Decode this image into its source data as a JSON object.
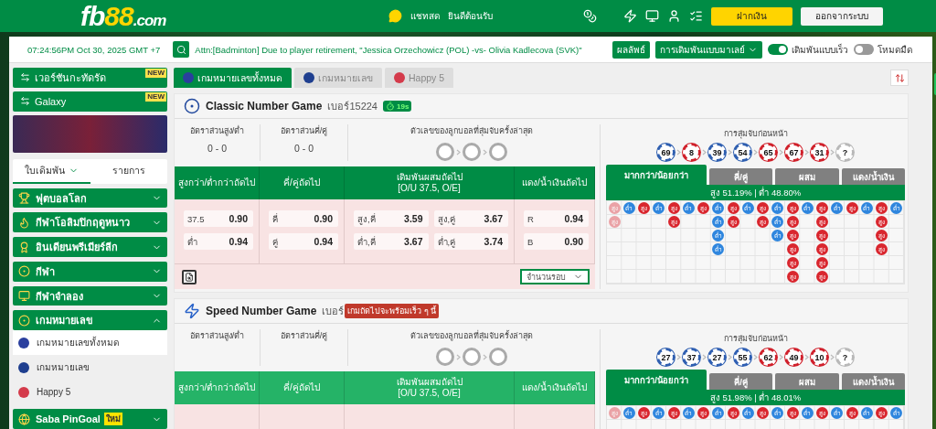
{
  "header": {
    "logo": [
      "fb",
      "88",
      ".com"
    ],
    "chat": "แชทสด",
    "welcome": "ยินดีต้อนรับ",
    "buttons": [
      {
        "label": "ฝากเงิน",
        "kind": "primary"
      },
      {
        "label": "ออกจากระบบ",
        "kind": "secondary"
      }
    ]
  },
  "ticker": {
    "time": "07:24:56PM Oct 30, 2025 GMT +7",
    "message": "Attn:[Badminton] Due to player retirement, \"Jessica Orzechowicz (POL) -vs- Olivia Kadlecova (SVK)\"",
    "results": "ผลลัพธ์",
    "odds_type": "การเดิมพันแบบมาเลย์",
    "toggles": [
      {
        "label": "เดิมพันแบบเร็ว",
        "on": true
      },
      {
        "label": "โหมดมืด",
        "on": false
      }
    ]
  },
  "sidebar": {
    "promos": [
      {
        "label": "เวอร์ชันกะทัดรัด",
        "badge": "NEW"
      },
      {
        "label": "Galaxy",
        "badge": "NEW"
      }
    ],
    "tabs": [
      {
        "label": "ใบเดิมพัน",
        "selected": true
      },
      {
        "label": "รายการ",
        "selected": false
      }
    ],
    "menu": [
      {
        "label": "ฟุตบอลโลก",
        "expanded": false
      },
      {
        "label": "กีฬาโอลิมปิกฤดูหนาว",
        "expanded": false
      },
      {
        "label": "อินเดียนพรีเมียร์ลีก",
        "expanded": false
      },
      {
        "label": "กีฬา",
        "expanded": false
      },
      {
        "label": "กีฬาจำลอง",
        "expanded": false
      },
      {
        "label": "เกมหมายเลข",
        "expanded": true,
        "children": [
          {
            "label": "เกมหมายเลขทั้งหมด",
            "selected": true
          },
          {
            "label": "เกมหมายเลข",
            "selected": false
          },
          {
            "label": "Happy 5",
            "selected": false
          }
        ]
      },
      {
        "label": "Saba PinGoal",
        "badge": "ใหม่",
        "expanded": false
      }
    ]
  },
  "game_tabs": [
    {
      "label": "เกมหมายเลขทั้งหมด",
      "selected": true
    },
    {
      "label": "เกมหมายเลข",
      "selected": false
    },
    {
      "label": "Happy 5",
      "selected": false
    }
  ],
  "games": [
    {
      "kind": "classic",
      "name": "Classic Number Game",
      "number": "เบอร์15224",
      "timer": "19s",
      "stats": [
        {
          "label": "อัตราส่วนสูง/ต่ำ",
          "value": "0 - 0"
        },
        {
          "label": "อัตราส่วนคี่/คู่",
          "value": "0 - 0"
        }
      ],
      "last_draw_label": "ตัวเลขของลูกบอลที่สุ่มจับครั้งล่าสุด",
      "prev_label": "การสุ่มจับก่อนหน้า",
      "prev_draws": [
        {
          "number": "69",
          "color": "#2f5fb0"
        },
        {
          "number": "8",
          "color": "#d0202a"
        },
        {
          "number": "39",
          "color": "#2f5fb0"
        },
        {
          "number": "54",
          "color": "#2f5fb0"
        },
        {
          "number": "65",
          "color": "#d0202a"
        },
        {
          "number": "67",
          "color": "#d0202a"
        },
        {
          "number": "31",
          "color": "#d0202a"
        },
        {
          "number": "?",
          "color": "#b8b8b8"
        }
      ],
      "columns": [
        {
          "title": "สูงกว่า/ต่ำกว่าถัดไป"
        },
        {
          "title": "คี่/คู่ถัดไป"
        },
        {
          "title": "เดิมพันผสมถัดไป",
          "subtitle": "[O/U 37.5, O/E]"
        },
        {
          "title": "แดง/น้ำเงินถัดไป"
        }
      ],
      "odds": [
        [
          {
            "label": "37.5",
            "value": "0.90"
          },
          {
            "label": "ต่ำ",
            "value": "0.94"
          }
        ],
        [
          {
            "label": "คี่",
            "value": "0.90"
          },
          {
            "label": "คู่",
            "value": "0.94"
          }
        ],
        [
          {
            "label": "สูง,คี่",
            "value": "3.59"
          },
          {
            "label": "สูง,คู่",
            "value": "3.67"
          },
          {
            "label": "ต่ำ,คี่",
            "value": "3.67"
          },
          {
            "label": "ต่ำ,คู่",
            "value": "3.74"
          }
        ],
        [
          {
            "label": "R",
            "value": "0.94"
          },
          {
            "label": "B",
            "value": "0.90"
          }
        ]
      ],
      "rounds": "จำนวนรอบ",
      "trend_tabs": [
        {
          "label": "มากกว่า/น้อยกว่า",
          "selected": true
        },
        {
          "label": "คี่/คู่",
          "selected": false
        },
        {
          "label": "ผสม",
          "selected": false
        },
        {
          "label": "แดง/น้ำเงิน",
          "selected": false
        }
      ],
      "summary": "สูง 51.19% | ต่ำ 48.80%",
      "road": [
        {
          "faded": true,
          "cells": [
            {
              "label": "สูง",
              "kind": "high"
            },
            {
              "label": "สูง",
              "kind": "high"
            }
          ]
        },
        {
          "faded": false,
          "cells": [
            {
              "label": "ต่ำ",
              "kind": "low"
            }
          ]
        },
        {
          "faded": false,
          "cells": [
            {
              "label": "สูง",
              "kind": "high"
            }
          ]
        },
        {
          "faded": false,
          "cells": [
            {
              "label": "ต่ำ",
              "kind": "low"
            }
          ]
        },
        {
          "faded": false,
          "cells": [
            {
              "label": "สูง",
              "kind": "high"
            },
            {
              "label": "สูง",
              "kind": "high"
            }
          ]
        },
        {
          "faded": false,
          "cells": [
            {
              "label": "ต่ำ",
              "kind": "low"
            }
          ]
        },
        {
          "faded": false,
          "cells": [
            {
              "label": "สูง",
              "kind": "high"
            }
          ]
        },
        {
          "faded": false,
          "cells": [
            {
              "label": "ต่ำ",
              "kind": "low"
            },
            {
              "label": "ต่ำ",
              "kind": "low"
            },
            {
              "label": "ต่ำ",
              "kind": "low"
            },
            {
              "label": "ต่ำ",
              "kind": "low"
            }
          ]
        },
        {
          "faded": false,
          "cells": [
            {
              "label": "สูง",
              "kind": "high"
            },
            {
              "label": "สูง",
              "kind": "high"
            }
          ]
        },
        {
          "faded": false,
          "cells": [
            {
              "label": "ต่ำ",
              "kind": "low"
            }
          ]
        },
        {
          "faded": false,
          "cells": [
            {
              "label": "สูง",
              "kind": "high"
            },
            {
              "label": "สูง",
              "kind": "high"
            }
          ]
        },
        {
          "faded": false,
          "cells": [
            {
              "label": "ต่ำ",
              "kind": "low"
            },
            {
              "label": "ต่ำ",
              "kind": "low"
            },
            {
              "label": "ต่ำ",
              "kind": "low"
            }
          ]
        },
        {
          "faded": false,
          "cells": [
            {
              "label": "สูง",
              "kind": "high"
            },
            {
              "label": "สูง",
              "kind": "high"
            },
            {
              "label": "สูง",
              "kind": "high"
            },
            {
              "label": "สูง",
              "kind": "high"
            },
            {
              "label": "สูง",
              "kind": "high"
            },
            {
              "label": "สูง",
              "kind": "high"
            }
          ]
        },
        {
          "faded": false,
          "cells": [
            {
              "label": "ต่ำ",
              "kind": "low"
            }
          ]
        },
        {
          "faded": false,
          "cells": [
            {
              "label": "สูง",
              "kind": "high"
            },
            {
              "label": "สูง",
              "kind": "high"
            },
            {
              "label": "สูง",
              "kind": "high"
            },
            {
              "label": "สูง",
              "kind": "high"
            },
            {
              "label": "สูง",
              "kind": "high"
            },
            {
              "label": "สูง",
              "kind": "high"
            }
          ]
        },
        {
          "faded": false,
          "cells": [
            {
              "label": "ต่ำ",
              "kind": "low"
            }
          ]
        },
        {
          "faded": false,
          "cells": [
            {
              "label": "สูง",
              "kind": "high"
            }
          ]
        },
        {
          "faded": false,
          "cells": [
            {
              "label": "ต่ำ",
              "kind": "low"
            }
          ]
        },
        {
          "faded": false,
          "cells": [
            {
              "label": "สูง",
              "kind": "high"
            },
            {
              "label": "สูง",
              "kind": "high"
            },
            {
              "label": "สูง",
              "kind": "high"
            },
            {
              "label": "สูง",
              "kind": "high"
            }
          ]
        },
        {
          "faded": false,
          "cells": [
            {
              "label": "ต่ำ",
              "kind": "low"
            }
          ]
        }
      ]
    },
    {
      "kind": "speed",
      "name": "Speed Number Game",
      "number": "เบอร์",
      "notice": "เกมถัดไปจะพร้อมเร็ว ๆ นี้",
      "stats": [
        {
          "label": "อัตราส่วนสูง/ต่ำ"
        },
        {
          "label": "อัตราส่วนคี่/คู่"
        }
      ],
      "last_draw_label": "ตัวเลขของลูกบอลที่สุ่มจับครั้งล่าสุด",
      "prev_label": "การสุ่มจับก่อนหน้า",
      "prev_draws": [
        {
          "number": "27",
          "color": "#2f5fb0"
        },
        {
          "number": "37",
          "color": "#2f5fb1"
        },
        {
          "number": "27",
          "color": "#2f5fb2"
        },
        {
          "number": "55",
          "color": "#2f5fb3"
        },
        {
          "number": "62",
          "color": "#d0202a"
        },
        {
          "number": "49",
          "color": "#d0202b"
        },
        {
          "number": "10",
          "color": "#d0202c"
        },
        {
          "number": "?",
          "color": "#b8b8b8"
        }
      ],
      "columns": [
        {
          "title": "สูงกว่า/ต่ำกว่าถัดไป"
        },
        {
          "title": "คี่/คู่ถัดไป"
        },
        {
          "title": "เดิมพันผสมถัดไป",
          "subtitle": "[O/U 37.5, O/E]"
        },
        {
          "title": "แดง/น้ำเงินถัดไป"
        }
      ],
      "trend_tabs": [
        {
          "label": "มากกว่า/น้อยกว่า",
          "selected": true
        },
        {
          "label": "คี่/คู่",
          "selected": false
        },
        {
          "label": "ผสม",
          "selected": false
        },
        {
          "label": "แดง/น้ำเงิน",
          "selected": false
        }
      ],
      "summary": "สูง 51.98% | ต่ำ 48.01%",
      "road": [
        {
          "faded": true,
          "cells": [
            {
              "label": "สูง",
              "kind": "high"
            }
          ]
        },
        {
          "faded": false,
          "cells": [
            {
              "label": "ต่ำ",
              "kind": "low"
            }
          ]
        },
        {
          "faded": false,
          "cells": [
            {
              "label": "สูง",
              "kind": "high"
            }
          ]
        },
        {
          "faded": false,
          "cells": [
            {
              "label": "ต่ำ",
              "kind": "low"
            }
          ]
        },
        {
          "faded": false,
          "cells": [
            {
              "label": "สูง",
              "kind": "high"
            }
          ]
        },
        {
          "faded": false,
          "cells": [
            {
              "label": "ต่ำ",
              "kind": "low"
            }
          ]
        },
        {
          "faded": false,
          "cells": [
            {
              "label": "สูง",
              "kind": "high"
            }
          ]
        },
        {
          "faded": false,
          "cells": [
            {
              "label": "ต่ำ",
              "kind": "low"
            }
          ]
        },
        {
          "faded": false,
          "cells": [
            {
              "label": "สูง",
              "kind": "high"
            }
          ]
        },
        {
          "faded": false,
          "cells": [
            {
              "label": "ต่ำ",
              "kind": "low"
            }
          ]
        },
        {
          "faded": false,
          "cells": [
            {
              "label": "สูง",
              "kind": "high"
            }
          ]
        },
        {
          "faded": false,
          "cells": [
            {
              "label": "ต่ำ",
              "kind": "low"
            }
          ]
        },
        {
          "faded": false,
          "cells": [
            {
              "label": "สูง",
              "kind": "high"
            }
          ]
        },
        {
          "faded": false,
          "cells": [
            {
              "label": "ต่ำ",
              "kind": "low"
            }
          ]
        },
        {
          "faded": false,
          "cells": [
            {
              "label": "สูง",
              "kind": "high"
            }
          ]
        },
        {
          "faded": false,
          "cells": [
            {
              "label": "ต่ำ",
              "kind": "low"
            }
          ]
        },
        {
          "faded": false,
          "cells": [
            {
              "label": "สูง",
              "kind": "high"
            }
          ]
        },
        {
          "faded": false,
          "cells": [
            {
              "label": "ต่ำ",
              "kind": "low"
            }
          ]
        },
        {
          "faded": false,
          "cells": [
            {
              "label": "สูง",
              "kind": "high"
            }
          ]
        },
        {
          "faded": false,
          "cells": [
            {
              "label": "ต่ำ",
              "kind": "low"
            }
          ]
        }
      ]
    }
  ]
}
